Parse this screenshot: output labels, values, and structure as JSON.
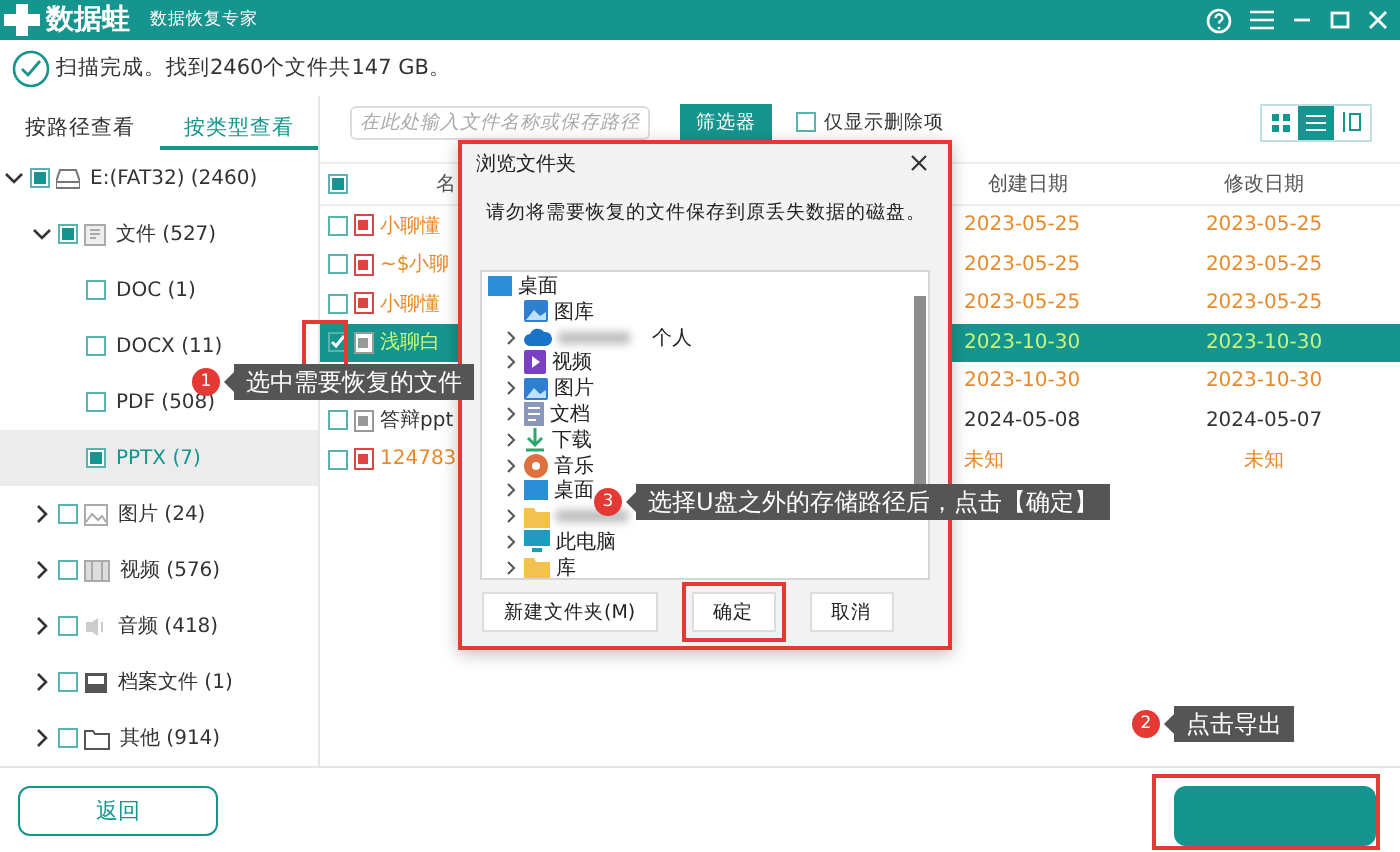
{
  "app": {
    "name": "数据蛙",
    "subtitle": "数据恢复专家"
  },
  "status": "扫描完成。找到2460个文件共147 GB。",
  "view_tabs": [
    {
      "label": "按路径查看",
      "selected": false
    },
    {
      "label": "按类型查看",
      "selected": true
    }
  ],
  "tree": [
    {
      "label": "E:(FAT32) (2460)",
      "kind": "drive",
      "checked": false,
      "indeterminate": true,
      "expanded": true,
      "selected": false,
      "children": [
        {
          "label": "文件 (527)",
          "kind": "document",
          "checked": false,
          "indeterminate": true,
          "expanded": true,
          "selected": false,
          "children": [
            {
              "label": "DOC (1)",
              "checked": false,
              "indeterminate": false,
              "selected": false
            },
            {
              "label": "DOCX (11)",
              "checked": false,
              "indeterminate": false,
              "selected": false
            },
            {
              "label": "PDF (508)",
              "checked": false,
              "indeterminate": false,
              "selected": false
            },
            {
              "label": "PPTX (7)",
              "checked": false,
              "indeterminate": true,
              "selected": true
            }
          ]
        },
        {
          "label": "图片 (24)",
          "kind": "image",
          "checked": false,
          "indeterminate": false,
          "expanded": false,
          "selected": false
        },
        {
          "label": "视频 (576)",
          "kind": "video",
          "checked": false,
          "indeterminate": false,
          "expanded": false,
          "selected": false
        },
        {
          "label": "音频 (418)",
          "kind": "audio",
          "checked": false,
          "indeterminate": false,
          "expanded": false,
          "selected": false
        },
        {
          "label": "档案文件 (1)",
          "kind": "archive",
          "checked": false,
          "indeterminate": false,
          "expanded": false,
          "selected": false
        },
        {
          "label": "其他 (914)",
          "kind": "folder",
          "checked": false,
          "indeterminate": false,
          "expanded": false,
          "selected": false
        }
      ]
    }
  ],
  "toolbar": {
    "search_placeholder": "在此处输入文件名称或保存路径",
    "filter_button": "筛选器",
    "deleted_only": {
      "label": "仅显示删除项",
      "checked": false
    },
    "view_modes": [
      {
        "kind": "grid",
        "selected": false
      },
      {
        "kind": "list",
        "selected": true
      },
      {
        "kind": "columns",
        "selected": false
      }
    ]
  },
  "table": {
    "checked": false,
    "indeterminate": true,
    "columns": [
      "名",
      "创建日期",
      "修改日期"
    ],
    "rows": [
      {
        "name": "小聊懂",
        "created": "2023-05-25",
        "modified": "2023-05-25",
        "checked": false,
        "selected": false,
        "deleted": true,
        "highlighted": false
      },
      {
        "name": "~$小聊",
        "created": "2023-05-25",
        "modified": "2023-05-25",
        "checked": false,
        "selected": false,
        "deleted": true,
        "highlighted": false
      },
      {
        "name": "小聊懂",
        "created": "2023-05-25",
        "modified": "2023-05-25",
        "checked": false,
        "selected": false,
        "deleted": true,
        "highlighted": false
      },
      {
        "name": "浅聊白",
        "created": "2023-10-30",
        "modified": "2023-10-30",
        "checked": true,
        "selected": true,
        "deleted": true,
        "highlighted": true
      },
      {
        "created": "2023-10-30",
        "modified": "2023-10-30",
        "selected": false,
        "deleted": true,
        "highlighted": false
      },
      {
        "name": "答辩ppt",
        "created": "2024-05-08",
        "modified": "2024-05-07",
        "checked": false,
        "selected": false,
        "deleted": false,
        "highlighted": false
      },
      {
        "name": "124783",
        "created": "未知",
        "modified": "未知",
        "checked": false,
        "selected": false,
        "deleted": true,
        "highlighted": false
      }
    ]
  },
  "dialog": {
    "title": "浏览文件夹",
    "message": "请勿将需要恢复的文件保存到原丢失数据的磁盘。",
    "highlighted": true,
    "folders": [
      {
        "label": "桌面",
        "kind": "desktop",
        "children": [
          {
            "label": "图库",
            "kind": "gallery",
            "expandable": false
          },
          {
            "label": "个人",
            "kind": "cloud",
            "expandable": true,
            "blurred": true
          },
          {
            "label": "视频",
            "kind": "video",
            "expandable": true
          },
          {
            "label": "图片",
            "kind": "gallery",
            "expandable": true
          },
          {
            "label": "文档",
            "kind": "documents",
            "expandable": true
          },
          {
            "label": "下载",
            "kind": "downloads",
            "expandable": true
          },
          {
            "label": "音乐",
            "kind": "music",
            "expandable": true
          },
          {
            "label": "桌面",
            "kind": "desktop",
            "expandable": true
          },
          {
            "kind": "folder",
            "expandable": true,
            "blurred": true
          },
          {
            "label": "此电脑",
            "kind": "computer",
            "expandable": true
          },
          {
            "label": "库",
            "kind": "folder",
            "expandable": true
          }
        ]
      }
    ],
    "buttons": [
      {
        "label": "新建文件夹(M)",
        "highlighted": false
      },
      {
        "label": "确定",
        "highlighted": true
      },
      {
        "label": "取消",
        "highlighted": false
      }
    ]
  },
  "callouts": [
    {
      "number": "1",
      "text": "选中需要恢复的文件"
    },
    {
      "number": "3",
      "text": "选择U盘之外的存储路径后，点击【确定】"
    },
    {
      "number": "2",
      "text": "点击导出"
    }
  ],
  "bottom": {
    "back_button": "返回",
    "export_button": {
      "highlighted": true
    }
  }
}
